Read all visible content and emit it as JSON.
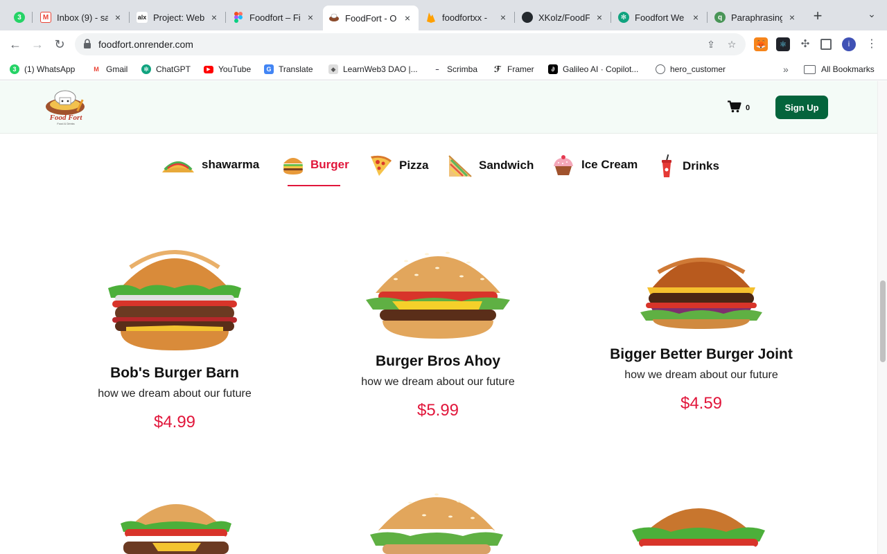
{
  "browser": {
    "tabs": [
      {
        "title": "",
        "icon": "whatsapp-icon",
        "color": "#25d366",
        "badge": "3"
      },
      {
        "title": "Inbox (9) - sa",
        "icon": "gmail-icon",
        "color": "#ea4335"
      },
      {
        "title": "Project: Web",
        "icon": "alx-icon",
        "color": "#222222"
      },
      {
        "title": "Foodfort – Fi",
        "icon": "figma-icon",
        "color": "#f24e1e"
      },
      {
        "title": "FoodFort - O",
        "icon": "foodfort-icon",
        "color": "#c0392b",
        "active": true
      },
      {
        "title": "foodfortxx - ",
        "icon": "firebase-icon",
        "color": "#ffa000"
      },
      {
        "title": "XKolz/FoodF",
        "icon": "github-icon",
        "color": "#24292e"
      },
      {
        "title": "Foodfort We",
        "icon": "chatgpt-icon",
        "color": "#10a37f"
      },
      {
        "title": "Paraphrasing",
        "icon": "quillbot-icon",
        "color": "#499557"
      }
    ],
    "new_tab": "+",
    "url": "foodfort.onrender.com",
    "profile_initial": "i",
    "bookmarks": [
      {
        "label": "(1) WhatsApp",
        "icon": "whatsapp-icon",
        "color": "#25d366"
      },
      {
        "label": "Gmail",
        "icon": "gmail-icon",
        "color": "#ea4335"
      },
      {
        "label": "ChatGPT",
        "icon": "chatgpt-icon",
        "color": "#10a37f"
      },
      {
        "label": "YouTube",
        "icon": "youtube-icon",
        "color": "#ff0000"
      },
      {
        "label": "Translate",
        "icon": "translate-icon",
        "color": "#4285f4"
      },
      {
        "label": "LearnWeb3 DAO |...",
        "icon": "learnweb3-icon",
        "color": "#555555"
      },
      {
        "label": "Scrimba",
        "icon": "scrimba-icon",
        "color": "#2b283a"
      },
      {
        "label": "Framer",
        "icon": "framer-icon",
        "color": "#000000"
      },
      {
        "label": "Galileo AI · Copilot...",
        "icon": "galileo-icon",
        "color": "#000000"
      },
      {
        "label": "hero_customer",
        "icon": "globe-icon",
        "color": "#5f6368"
      }
    ],
    "more_bookmarks": "»",
    "all_bookmarks": "All Bookmarks"
  },
  "site": {
    "logo_line1": "Food Fort",
    "logo_line2": "Food & Drinks",
    "cart_count": "0",
    "signup_label": "Sign Up",
    "categories": [
      {
        "label": "shawarma",
        "icon": "taco-icon"
      },
      {
        "label": "Burger",
        "icon": "burger-icon",
        "active": true
      },
      {
        "label": "Pizza",
        "icon": "pizza-icon"
      },
      {
        "label": "Sandwich",
        "icon": "sandwich-icon"
      },
      {
        "label": "Ice Cream",
        "icon": "cupcake-icon"
      },
      {
        "label": "Drinks",
        "icon": "drink-cup-icon"
      }
    ],
    "products": [
      {
        "name": "Bob's Burger Barn",
        "desc": "how we dream about our future",
        "price": "$4.99"
      },
      {
        "name": "Burger Bros Ahoy",
        "desc": "how we dream about our future",
        "price": "$5.99"
      },
      {
        "name": "Bigger Better Burger Joint",
        "desc": "how we dream about our future",
        "price": "$4.59"
      }
    ],
    "colors": {
      "accent": "#e1163b",
      "primary": "#04643c",
      "header_bg": "#f4fbf7"
    }
  }
}
